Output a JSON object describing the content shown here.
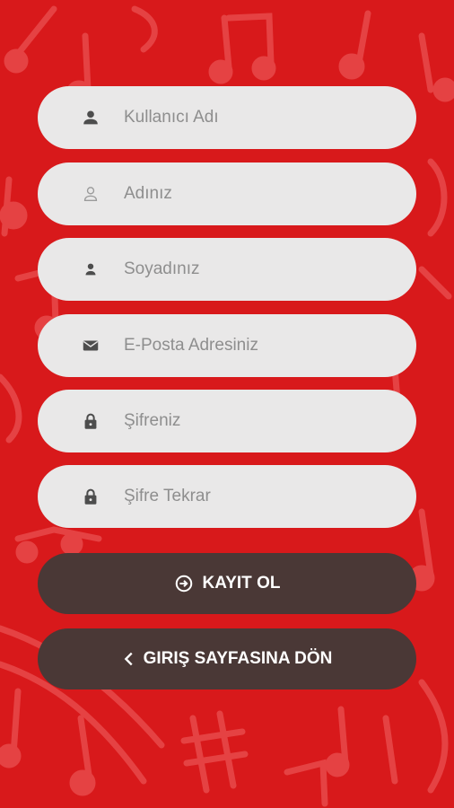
{
  "form": {
    "fields": [
      {
        "placeholder": "Kullanıcı Adı",
        "value": "",
        "icon": "person-icon"
      },
      {
        "placeholder": "Adınız",
        "value": "",
        "icon": "person-outline-icon"
      },
      {
        "placeholder": "Soyadınız",
        "value": "",
        "icon": "person-small-icon"
      },
      {
        "placeholder": "E-Posta Adresiniz",
        "value": "",
        "icon": "mail-icon"
      },
      {
        "placeholder": "Şifreniz",
        "value": "",
        "icon": "lock-icon"
      },
      {
        "placeholder": "Şifre Tekrar",
        "value": "",
        "icon": "lock-icon"
      }
    ]
  },
  "buttons": {
    "register_label": "KAYIT OL",
    "register_icon": "login-icon",
    "back_label": "GIRIŞ SAYFASINA DÖN",
    "back_icon": "chevron-left-icon"
  },
  "colors": {
    "background": "#d8191b",
    "field_background": "#e9e8e8",
    "button_background": "#4a3836",
    "button_text": "#ffffff",
    "icon": "#4d4d4d"
  }
}
